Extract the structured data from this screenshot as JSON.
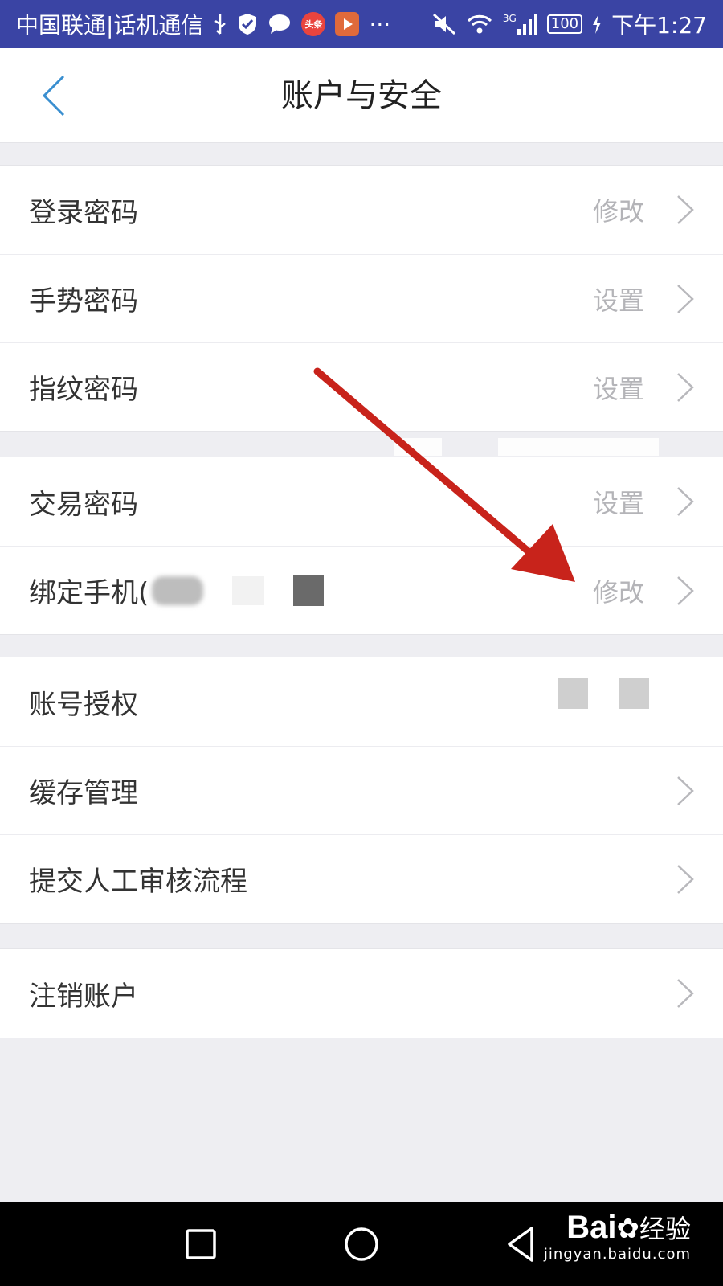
{
  "status_bar": {
    "carrier": "中国联通|话机通信",
    "app_badge": "头条",
    "more": "···",
    "network": "3G",
    "battery": "100",
    "time": "下午1:27"
  },
  "header": {
    "back_icon": "chevron-left-icon",
    "title": "账户与安全"
  },
  "groups": [
    {
      "items": [
        {
          "label": "登录密码",
          "action": "修改"
        },
        {
          "label": "手势密码",
          "action": "设置"
        },
        {
          "label": "指纹密码",
          "action": "设置"
        }
      ]
    },
    {
      "items": [
        {
          "label": "交易密码",
          "action": "设置"
        },
        {
          "label": "绑定手机(",
          "action": "修改"
        }
      ]
    },
    {
      "items": [
        {
          "label": "账号授权",
          "action": ""
        },
        {
          "label": "缓存管理",
          "action": ""
        },
        {
          "label": "提交人工审核流程",
          "action": ""
        }
      ]
    },
    {
      "items": [
        {
          "label": "注销账户",
          "action": ""
        }
      ]
    }
  ],
  "annotation": {
    "color": "#c8231b",
    "icon": "red-arrow-annotation"
  },
  "system_nav": {
    "buttons": [
      "recent-apps-icon",
      "home-icon",
      "back-icon"
    ]
  },
  "watermark": {
    "logo": "Bai",
    "suffix": "经验",
    "url": "jingyan.baidu.com"
  },
  "colors": {
    "status_bar": "#3a44a4",
    "accent": "#3a8fd0",
    "background": "#eeeef2"
  }
}
